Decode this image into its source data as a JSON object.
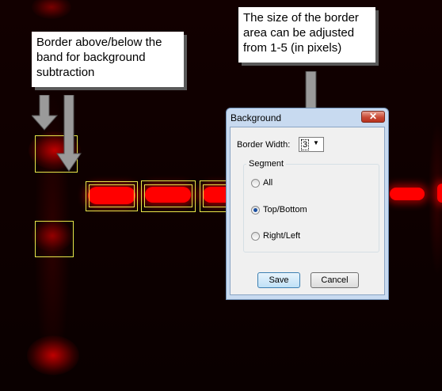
{
  "callouts": {
    "left": "Border above/below the band for background subtraction",
    "right": "The size of the border area can be adjusted from 1-5 (in pixels)"
  },
  "dialog": {
    "title": "Background",
    "close_label": "✕",
    "border_width_label": "Border Width:",
    "border_width_value": "3",
    "segment_label": "Segment",
    "options": [
      {
        "label": "All",
        "checked": false
      },
      {
        "label": "Top/Bottom",
        "checked": true
      },
      {
        "label": "Right/Left",
        "checked": false
      }
    ],
    "save_label": "Save",
    "cancel_label": "Cancel"
  },
  "colors": {
    "band": "#ff0000",
    "border_box": "#e8e84a",
    "background": "#0a0000"
  }
}
